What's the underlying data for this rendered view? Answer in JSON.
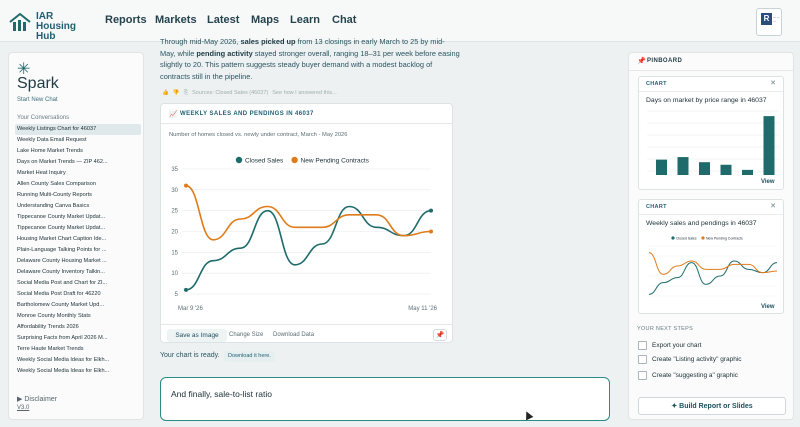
{
  "brand": {
    "name_line1": "IAR",
    "name_line2": "Housing Hub"
  },
  "nav": [
    "Reports",
    "Markets",
    "Latest",
    "Maps",
    "Learn",
    "Chat"
  ],
  "sidebar": {
    "title": "Spark",
    "new_chat": "Start New Chat",
    "conversations_header": "Your Conversations",
    "conversations": [
      "Weekly Listings Chart for 46037",
      "Weekly Data Email Request",
      "Lake Home Market Trends",
      "Days on Market Trends — ZIP 462...",
      "Market Heat Inquiry",
      "Allen County Sales Comparison",
      "Running Multi-County Reports",
      "Understanding Canva Basics",
      "Tippecanoe County Market Updat...",
      "Tippecanoe County Market Updat...",
      "Housing Market Chart Caption Ide...",
      "Plain-Language Talking Points for ...",
      "Delaware County Housing Market ...",
      "Delaware County Inventory Talkin...",
      "Social Media Post and Chart for ZI...",
      "Social Media Post Draft for 46220",
      "Bartholomew County Market Upd...",
      "Monroe County Monthly Stats",
      "Affordability Trends 2026",
      "Surprising Facts from April 2026 M...",
      "Terre Haute Market Trends",
      "Weekly Social Media Ideas for Elkh...",
      "Weekly Social Media Ideas for Elkh..."
    ],
    "disclaimer": "Disclaimer",
    "version": "V3.0"
  },
  "message": {
    "p1": "Through mid-May 2026, ",
    "b1": "sales picked up",
    "p2": " from 13 closings in early March to 25 by mid-May, while ",
    "b2": "pending activity",
    "p3": " stayed stronger overall, ranging 18–31 per week before easing slightly to 20. This pattern suggests steady buyer demand with a modest backlog of contracts still in the pipeline.",
    "sources": "Sources: Closed Sales (46037)",
    "see_how": "See how I answered this..."
  },
  "main_chart": {
    "header": "WEEKLY SALES AND PENDINGS IN 46037",
    "subtitle": "Number of homes closed vs. newly under contract, March - May 2026",
    "save_label": "Save as Image",
    "change_size_label": "Change Size",
    "download_data_label": "Download Data"
  },
  "chart_data": {
    "type": "line",
    "x": [
      "Mar 9 '26",
      "Mar 16 '26",
      "Mar 23 '26",
      "Mar 30 '26",
      "Apr 6 '26",
      "Apr 13 '26",
      "Apr 20 '26",
      "Apr 27 '26",
      "May 4 '26",
      "May 11 '26"
    ],
    "x_tick_labels": [
      "Mar 9 '26",
      "May 11 '26"
    ],
    "ylim": [
      5,
      35
    ],
    "yticks": [
      5,
      10,
      15,
      20,
      25,
      30,
      35
    ],
    "grid": true,
    "legend": "top-center",
    "series": [
      {
        "name": "Closed Sales",
        "color": "#1f6b6b",
        "values": [
          6,
          13,
          16,
          25,
          12,
          17,
          26,
          21,
          19,
          25
        ]
      },
      {
        "name": "New Pending Contracts",
        "color": "#e07b1a",
        "values": [
          31,
          18,
          23,
          26,
          21,
          21,
          24,
          24,
          19,
          20
        ]
      }
    ]
  },
  "ready": {
    "text": "Your chart is ready.",
    "download": "Download it here."
  },
  "input": {
    "value": "And finally, sale-to-list ratio"
  },
  "pinboard": {
    "title": "PINBOARD",
    "cards": [
      {
        "label": "CHART",
        "name": "Days on market by price range in 46037",
        "view": "View",
        "bars": [
          12,
          14,
          10,
          8,
          4,
          46
        ]
      },
      {
        "label": "CHART",
        "name": "Weekly sales and pendings in 46037",
        "view": "View",
        "legend": [
          "Closed Sales",
          "New Pending Contracts"
        ]
      }
    ],
    "next_steps_header": "YOUR NEXT STEPS",
    "next_steps": [
      "Export your chart",
      "Create \"Listing activity\" graphic",
      "Create \"suggesting a\" graphic"
    ],
    "build_button": "Build Report or Slides"
  },
  "colors": {
    "accent": "#1f6b6b",
    "closed": "#1f6b6b",
    "pending": "#e07b1a",
    "input_border": "#2a8a85"
  },
  "icons": {
    "pin": "pin-icon",
    "chart": "chart-icon",
    "close": "close-icon",
    "spark": "spark-icon"
  }
}
